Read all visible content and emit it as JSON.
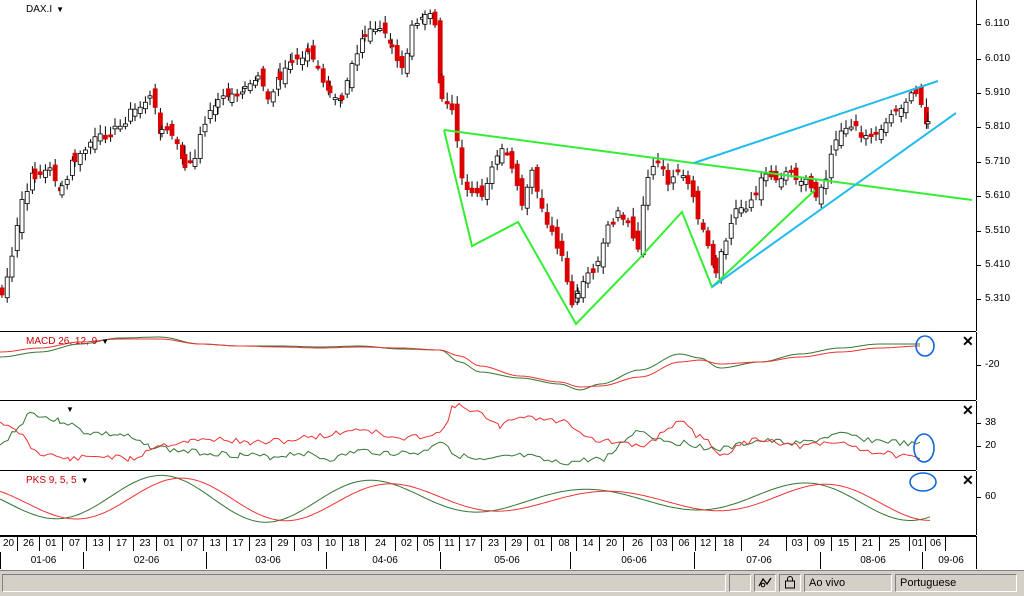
{
  "main": {
    "symbol": "DAX.I",
    "y_labels": [
      "6.110",
      "6.010",
      "5.910",
      "5.810",
      "5.710",
      "5.610",
      "5.510",
      "5.410",
      "5.310"
    ]
  },
  "macd": {
    "title": "MACD 26, 12, 9",
    "y_labels": [
      "-20"
    ]
  },
  "osc": {
    "y_labels": [
      "38",
      "20"
    ]
  },
  "pks": {
    "title": "PKS 9, 5, 5",
    "y_labels": [
      "60"
    ]
  },
  "xaxis": {
    "days": [
      "20",
      "26",
      "01",
      "07",
      "13",
      "17",
      "23",
      "01",
      "07",
      "13",
      "17",
      "23",
      "29",
      "03",
      "10",
      "18",
      "24",
      "02",
      "05",
      "11",
      "17",
      "23",
      "29",
      "01",
      "08",
      "14",
      "20",
      "26",
      "03",
      "06",
      "12",
      "18",
      "24",
      "03",
      "09",
      "15",
      "21",
      "25",
      "01",
      "06"
    ],
    "months": [
      "01-06",
      "02-06",
      "03-06",
      "04-06",
      "05-06",
      "06-06",
      "07-06",
      "08-06",
      "09-06"
    ]
  },
  "status": {
    "live_label": "Ao vivo",
    "language": "Portuguese"
  },
  "colors": {
    "candle_up": "#ffffff",
    "candle_down": "#dd0000",
    "green_pattern": "#33ee33",
    "blue_channel": "#22bbee",
    "line_green": "#337733",
    "line_red": "#ee3333",
    "circle": "#1166dd"
  },
  "icons": {
    "tool": "line-tool-icon",
    "lock": "lock-icon",
    "close": "close-icon"
  }
}
